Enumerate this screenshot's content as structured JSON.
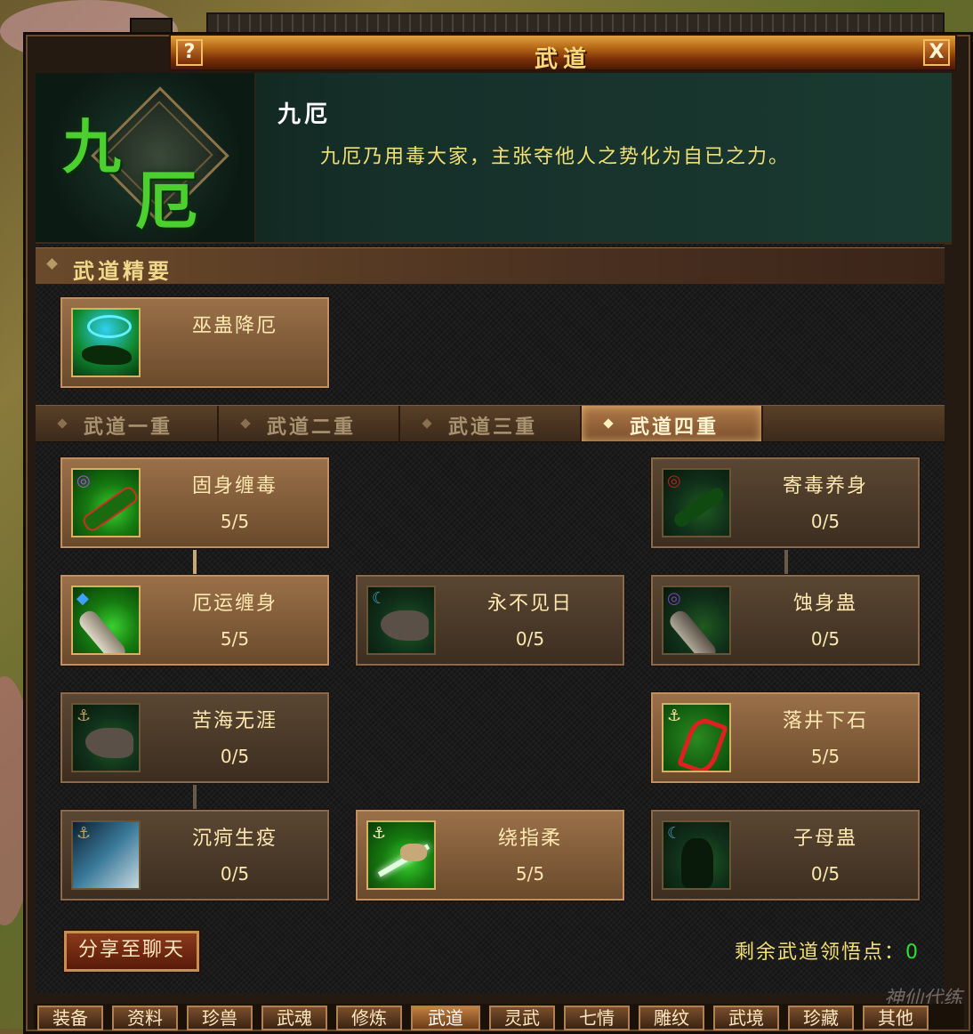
{
  "window": {
    "title": "武道",
    "help_icon": "question-icon",
    "close_icon": "close-icon",
    "help_label": "?",
    "close_label": "X"
  },
  "header": {
    "emblem_chars": [
      "九",
      "厄"
    ],
    "sect_name": "九厄",
    "description": "九厄乃用毒大家，主张夺他人之势化为自已之力。"
  },
  "section": {
    "title": "武道精要",
    "core_skill": {
      "name": "巫蛊降厄",
      "icon": "cursed-hand-icon"
    }
  },
  "tabs": [
    {
      "label": "武道一重",
      "active": false
    },
    {
      "label": "武道二重",
      "active": false
    },
    {
      "label": "武道三重",
      "active": false
    },
    {
      "label": "武道四重",
      "active": true
    }
  ],
  "skills": [
    {
      "name": "固身缠毒",
      "level": "5/5",
      "icon": "serpent-icon",
      "lit": true
    },
    {
      "name": "寄毒养身",
      "level": "0/5",
      "icon": "serpent-icon",
      "lit": false
    },
    {
      "name": "厄运缠身",
      "level": "5/5",
      "icon": "bandaged-arm-icon",
      "lit": true
    },
    {
      "name": "永不见日",
      "level": "0/5",
      "icon": "dark-hand-icon",
      "lit": false
    },
    {
      "name": "蚀身蛊",
      "level": "0/5",
      "icon": "bandaged-arm-icon",
      "lit": false
    },
    {
      "name": "苦海无涯",
      "level": "0/5",
      "icon": "dark-hand-icon",
      "lit": false
    },
    {
      "name": "落井下石",
      "level": "5/5",
      "icon": "red-figure-icon",
      "lit": true
    },
    {
      "name": "沉疴生疫",
      "level": "0/5",
      "icon": "sea-storm-icon",
      "lit": false
    },
    {
      "name": "绕指柔",
      "level": "5/5",
      "icon": "glowing-hand-icon",
      "lit": true
    },
    {
      "name": "子母蛊",
      "level": "0/5",
      "icon": "shadow-beast-icon",
      "lit": false
    }
  ],
  "footer": {
    "share_label": "分享至聊天",
    "points_label": "剩余武道领悟点：",
    "points_value": "0"
  },
  "bottom_tabs": [
    "装备",
    "资料",
    "珍兽",
    "武魂",
    "修炼",
    "武道",
    "灵武",
    "七情",
    "雕纹",
    "武境",
    "珍藏",
    "其他"
  ],
  "bottom_active": "武道",
  "watermark": "神仙代练",
  "colors": {
    "accent_gold": "#f2e070",
    "lit_card": "#9a7048",
    "points_value": "#30e030"
  }
}
